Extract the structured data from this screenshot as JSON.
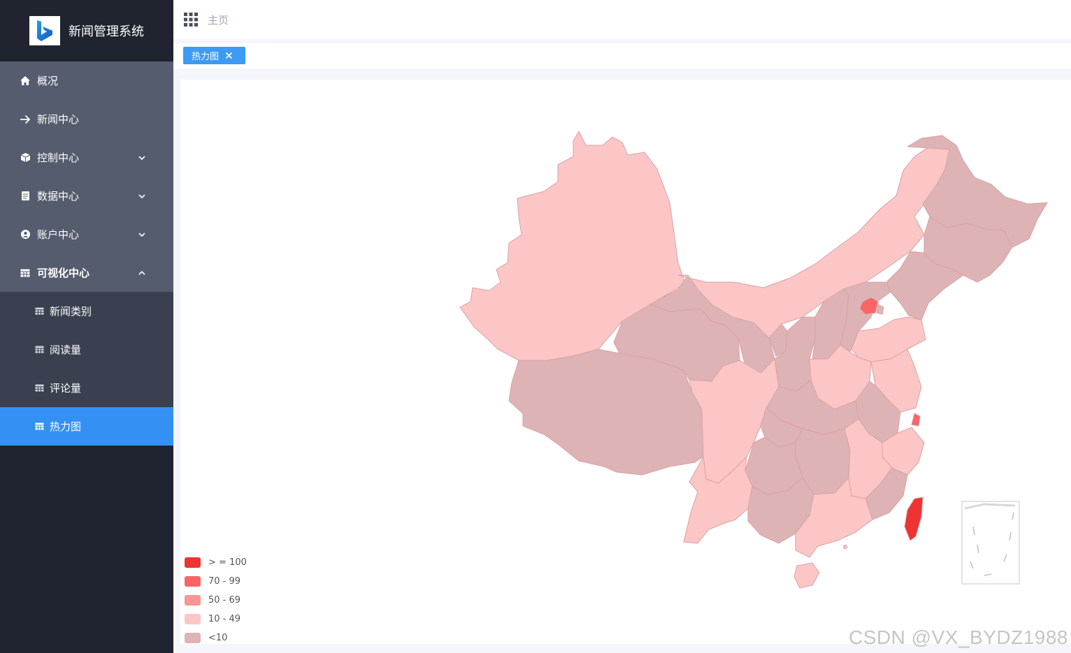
{
  "app": {
    "title": "新闻管理系统",
    "logo": "bing-logo"
  },
  "header": {
    "apps_icon": "grid-apps-icon",
    "breadcrumb": "主页"
  },
  "tabs": [
    {
      "label": "热力图",
      "close_icon": "close-icon"
    }
  ],
  "sidebar": {
    "items": [
      {
        "label": "概况",
        "icon": "home-icon"
      },
      {
        "label": "新闻中心",
        "icon": "arrow-right-icon"
      },
      {
        "label": "控制中心",
        "icon": "cube-icon",
        "expandable": true
      },
      {
        "label": "数据中心",
        "icon": "document-icon",
        "expandable": true
      },
      {
        "label": "账户中心",
        "icon": "user-circle-icon",
        "expandable": true
      },
      {
        "label": "可视化中心",
        "icon": "table-icon",
        "expandable": true,
        "expanded": true
      }
    ],
    "subitems": [
      {
        "label": "新闻类别",
        "icon": "table-icon"
      },
      {
        "label": "阅读量",
        "icon": "table-icon"
      },
      {
        "label": "评论量",
        "icon": "table-icon"
      },
      {
        "label": "热力图",
        "icon": "table-icon",
        "active": true
      }
    ]
  },
  "legend": [
    {
      "label": "> = 100",
      "color": "#ee3333"
    },
    {
      "label": "70 - 99",
      "color": "#f76565"
    },
    {
      "label": "50 - 69",
      "color": "#f89595"
    },
    {
      "label": "10 - 49",
      "color": "#fcc6c6"
    },
    {
      "label": "<10",
      "color": "#deb3b5"
    }
  ],
  "watermark": "CSDN @VX_BYDZ1988",
  "colors": {
    "sidebar_bg": "#1f2330",
    "menu_bg": "#545c6d",
    "submenu_bg": "#3b4050",
    "active": "#3590f4"
  }
}
